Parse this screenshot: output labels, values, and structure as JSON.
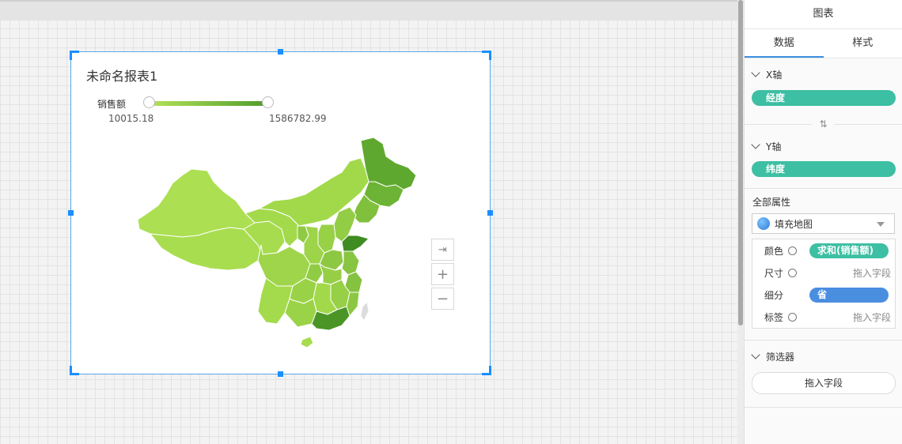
{
  "canvas": {
    "widget": {
      "title": "未命名报表1",
      "legend": {
        "label": "销售额",
        "min": "10015.18",
        "max": "1586782.99"
      },
      "zoom": {
        "reset_icon": "pin-icon",
        "in": "+",
        "out": "−"
      }
    }
  },
  "chart_data": {
    "type": "filled-map",
    "region": "China provinces",
    "measure": "销售额",
    "color_range": {
      "min": 10015.18,
      "max": 1586782.99,
      "min_color": "#b5e25a",
      "max_color": "#4f9c2a"
    }
  },
  "panel": {
    "title": "图表",
    "tabs": [
      {
        "label": "数据"
      },
      {
        "label": "样式"
      }
    ],
    "x_axis": {
      "label": "X轴",
      "field": "经度"
    },
    "swap_icon": "⇅",
    "y_axis": {
      "label": "Y轴",
      "field": "纬度"
    },
    "all_props_label": "全部属性",
    "chart_type": "填充地图",
    "props": [
      {
        "label": "颜色",
        "value": "求和(销售额)"
      },
      {
        "label": "尺寸",
        "value": "拖入字段"
      },
      {
        "label": "细分",
        "value": "省"
      },
      {
        "label": "标签",
        "value": "拖入字段"
      }
    ],
    "filter": {
      "label": "筛选器",
      "button": "拖入字段"
    }
  }
}
